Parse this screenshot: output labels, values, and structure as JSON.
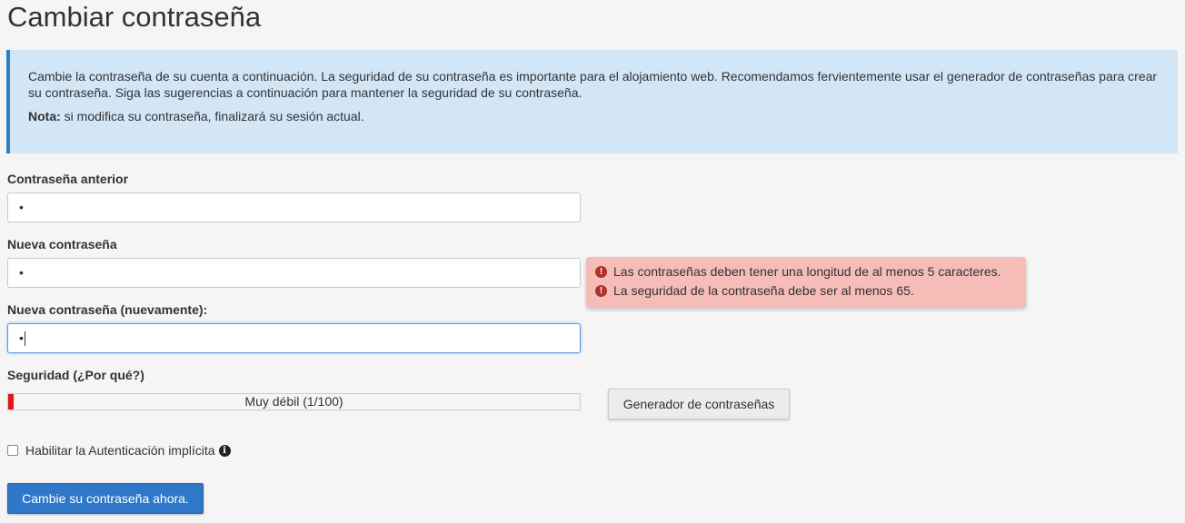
{
  "page": {
    "title": "Cambiar contraseña"
  },
  "info": {
    "paragraph": "Cambie la contraseña de su cuenta a continuación. La seguridad de su contraseña es importante para el alojamiento web. Recomendamos fervientemente usar el generador de contraseñas para crear su contraseña. Siga las sugerencias a continuación para mantener la seguridad de su contraseña.",
    "note_label": "Nota:",
    "note_text": " si modifica su contraseña, finalizará su sesión actual."
  },
  "form": {
    "old_password": {
      "label": "Contraseña anterior",
      "value": "•"
    },
    "new_password": {
      "label": "Nueva contraseña",
      "value": "•"
    },
    "new_password_again": {
      "label": "Nueva contraseña (nuevamente):",
      "value": "•"
    }
  },
  "errors": [
    "Las contraseñas deben tener una longitud de al menos 5 caracteres.",
    "La seguridad de la contraseña debe ser al menos 65."
  ],
  "strength": {
    "label": "Seguridad (¿Por qué?)",
    "text": "Muy débil (1/100)",
    "percent": 1,
    "color": "#e3151b"
  },
  "generator_button": "Generador de contraseñas",
  "implicit_auth": {
    "label": "Habilitar la Autenticación implícita",
    "checked": false
  },
  "submit_button": "Cambie su contraseña ahora."
}
